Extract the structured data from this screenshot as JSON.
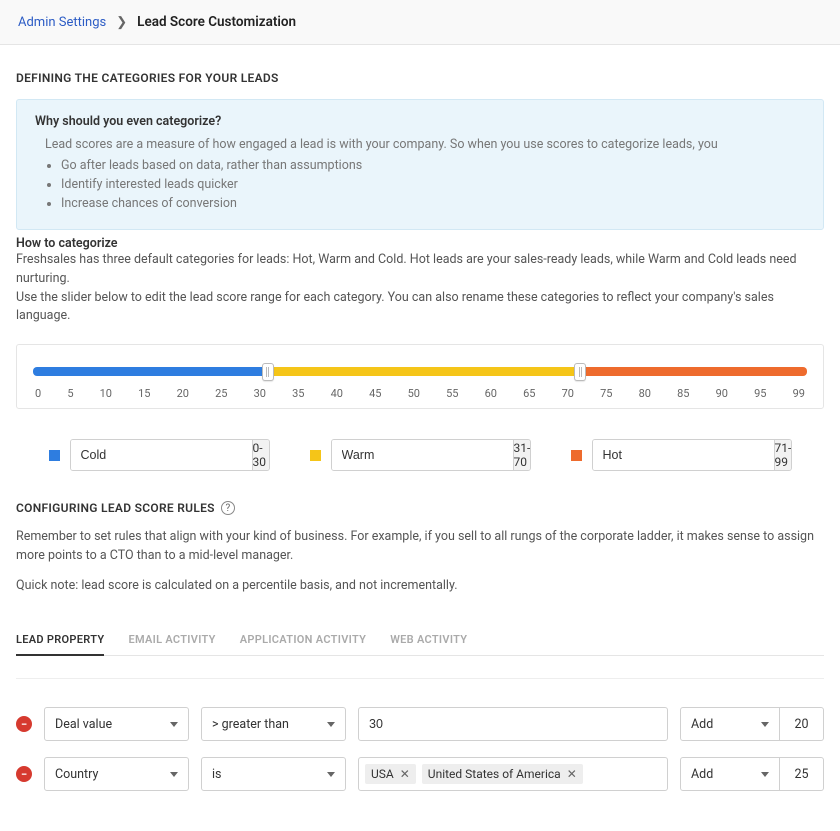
{
  "breadcrumb": {
    "root": "Admin Settings",
    "current": "Lead Score Customization"
  },
  "categories_section": {
    "title": "DEFINING THE CATEGORIES FOR YOUR LEADS",
    "info_title": "Why should you even categorize?",
    "info_lead": "Lead scores are a measure of how engaged a lead is with your company. So when you use scores to categorize leads, you",
    "bullets": [
      "Go after leads based on data, rather than assumptions",
      "Identify interested leads quicker",
      "Increase chances of conversion"
    ],
    "how_title": "How to categorize",
    "how_body": "Freshsales has three default categories for leads: Hot, Warm and Cold. Hot leads are your sales-ready leads, while Warm and Cold leads need nurturing.\nUse the slider below to edit the lead score range for each category. You can also rename these categories to reflect your company's sales language."
  },
  "slider": {
    "ticks": [
      "0",
      "5",
      "10",
      "15",
      "20",
      "25",
      "30",
      "35",
      "40",
      "45",
      "50",
      "55",
      "60",
      "65",
      "70",
      "75",
      "80",
      "85",
      "90",
      "95",
      "99"
    ],
    "break1": 30,
    "break2": 70,
    "min": 0,
    "max": 99
  },
  "categories": [
    {
      "color": "blue",
      "name": "Cold",
      "range": "0-30"
    },
    {
      "color": "yellow",
      "name": "Warm",
      "range": "31-70"
    },
    {
      "color": "orange",
      "name": "Hot",
      "range": "71-99"
    }
  ],
  "rules_section": {
    "title": "CONFIGURING LEAD SCORE RULES",
    "para1": "Remember to set rules that align with your kind of business. For example, if you sell to all rungs of the corporate ladder, it makes sense to assign more points to a CTO than to a mid-level manager.",
    "para2": "Quick note: lead score is calculated on a percentile basis, and not incrementally."
  },
  "tabs": [
    {
      "label": "LEAD  PROPERTY",
      "active": true
    },
    {
      "label": "EMAIL  ACTIVITY",
      "active": false
    },
    {
      "label": "APPLICATION  ACTIVITY",
      "active": false
    },
    {
      "label": "WEB  ACTIVITY",
      "active": false
    }
  ],
  "rules": [
    {
      "property": "Deal value",
      "operator": "> greater than",
      "value_type": "text",
      "value_text": "30",
      "action": "Add",
      "points": "20"
    },
    {
      "property": "Country",
      "operator": "is",
      "value_type": "chips",
      "chips": [
        "USA",
        "United States of America"
      ],
      "action": "Add",
      "points": "25"
    }
  ]
}
